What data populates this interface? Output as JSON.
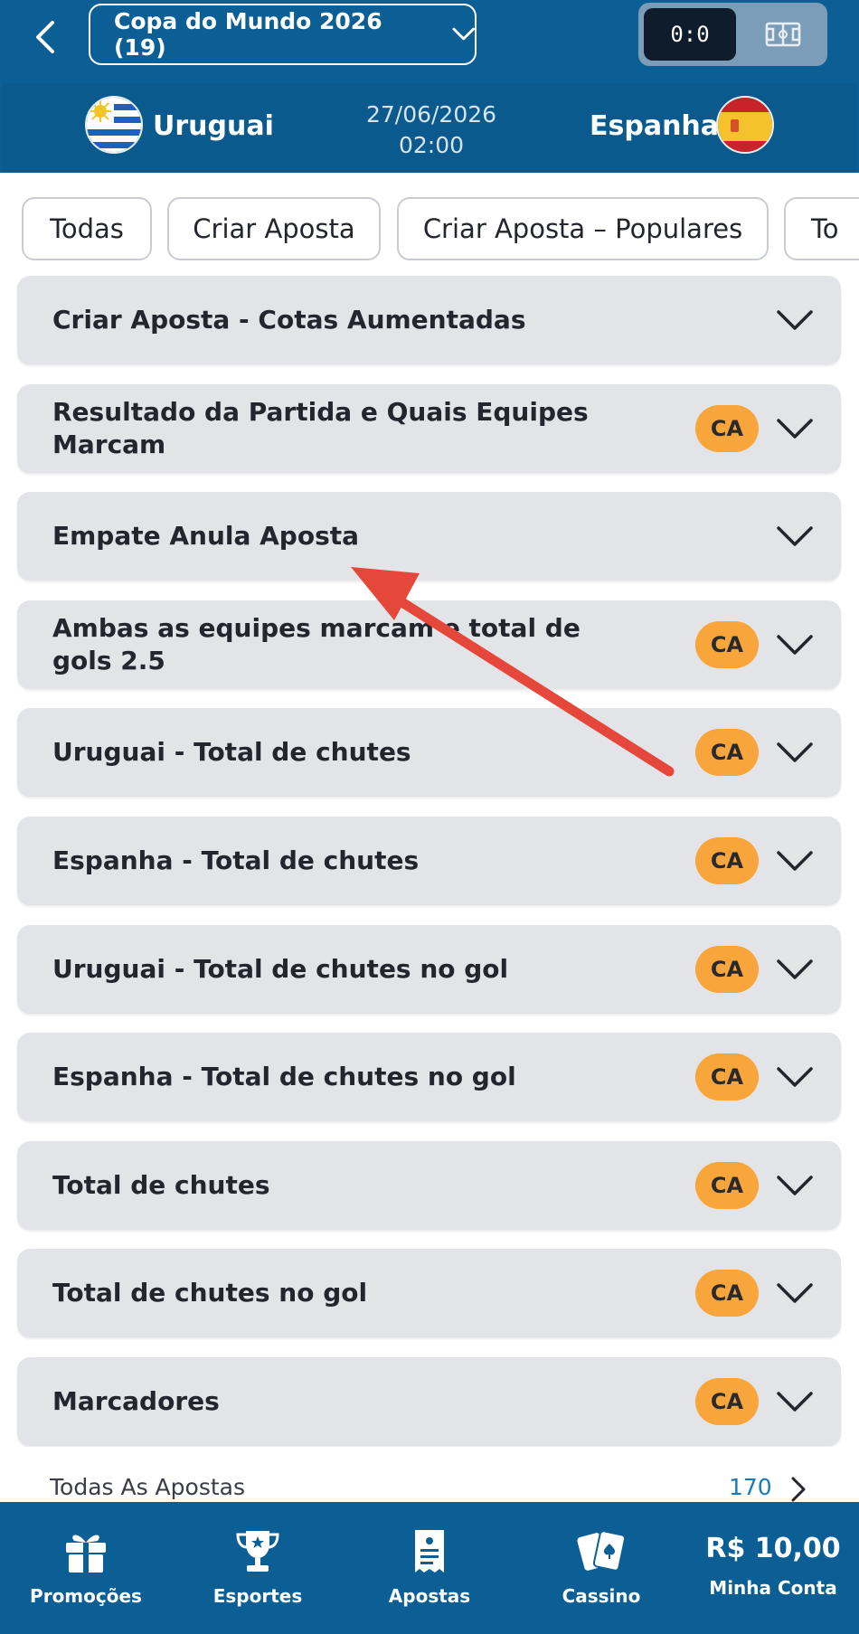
{
  "header": {
    "league_label": "Copa do Mundo 2026 (19)",
    "score_toggle": "0:0"
  },
  "match": {
    "home_team": "Uruguai",
    "away_team": "Espanha",
    "date": "27/06/2026",
    "time": "02:00"
  },
  "filters": [
    {
      "label": "Todas"
    },
    {
      "label": "Criar Aposta"
    },
    {
      "label": "Criar Aposta – Populares"
    },
    {
      "label": "To"
    }
  ],
  "markets": [
    {
      "title": "Criar Aposta - Cotas Aumentadas",
      "badge": ""
    },
    {
      "title": "Resultado da Partida e Quais Equipes Marcam",
      "badge": "CA"
    },
    {
      "title": "Empate Anula Aposta",
      "badge": ""
    },
    {
      "title": "Ambas as equipes marcam e total de gols 2.5",
      "badge": "CA"
    },
    {
      "title": "Uruguai - Total de chutes",
      "badge": "CA"
    },
    {
      "title": "Espanha - Total de chutes",
      "badge": "CA"
    },
    {
      "title": "Uruguai - Total de chutes no gol",
      "badge": "CA"
    },
    {
      "title": "Espanha - Total de chutes no gol",
      "badge": "CA"
    },
    {
      "title": "Total de chutes",
      "badge": "CA"
    },
    {
      "title": "Total de chutes no gol",
      "badge": "CA"
    },
    {
      "title": "Marcadores",
      "badge": "CA"
    }
  ],
  "all_bets": {
    "label": "Todas As Apostas",
    "count": "170"
  },
  "bottom_nav": [
    {
      "label": "Promoções",
      "icon": "gift-icon"
    },
    {
      "label": "Esportes",
      "icon": "trophy-icon"
    },
    {
      "label": "Apostas",
      "icon": "betslip-icon"
    },
    {
      "label": "Cassino",
      "icon": "cards-icon"
    }
  ],
  "account": {
    "balance": "R$ 10,00",
    "label": "Minha Conta"
  },
  "colors": {
    "brand": "#0b5f95",
    "badge": "#f8a63c",
    "arrow": "#e5483a"
  }
}
